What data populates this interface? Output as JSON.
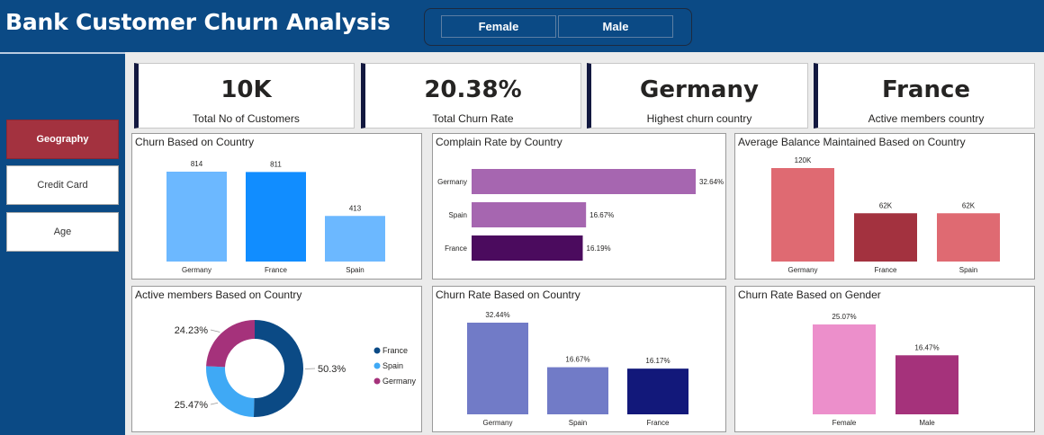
{
  "header": {
    "title": "Bank Customer Churn Analysis"
  },
  "gender_slicer": {
    "options": [
      "Female",
      "Male"
    ]
  },
  "sidebar": {
    "items": [
      {
        "label": "Geography",
        "active": true
      },
      {
        "label": "Credit Card",
        "active": false
      },
      {
        "label": "Age",
        "active": false
      }
    ]
  },
  "kpis": [
    {
      "value": "10K",
      "label": "Total No of Customers"
    },
    {
      "value": "20.38%",
      "label": "Total Churn Rate"
    },
    {
      "value": "Germany",
      "label": "Highest churn country"
    },
    {
      "value": "France",
      "label": "Active members country"
    }
  ],
  "colors": {
    "header": "#0b4a85",
    "active_nav": "#a3323f",
    "kpi_accent": "#12183f"
  },
  "chart_data": [
    {
      "type": "bar",
      "title": "Churn Based on Country",
      "categories": [
        "Germany",
        "France",
        "Spain"
      ],
      "values": [
        814,
        811,
        413
      ],
      "data_labels": [
        "814",
        "811",
        "413"
      ],
      "colors": [
        "#6cb8ff",
        "#118dff",
        "#6cb8ff"
      ]
    },
    {
      "type": "bar",
      "orientation": "horizontal",
      "title": "Complain Rate by Country",
      "categories": [
        "Germany",
        "Spain",
        "France"
      ],
      "values": [
        32.64,
        16.67,
        16.19
      ],
      "data_labels": [
        "32.64%",
        "16.67%",
        "16.19%"
      ],
      "colors": [
        "#a666b0",
        "#a666b0",
        "#4b0b5e"
      ]
    },
    {
      "type": "bar",
      "title": "Average Balance Maintained Based on Country",
      "categories": [
        "Germany",
        "France",
        "Spain"
      ],
      "values": [
        120,
        62,
        62
      ],
      "data_labels": [
        "120K",
        "62K",
        "62K"
      ],
      "colors": [
        "#df6a72",
        "#a3323f",
        "#df6a72"
      ]
    },
    {
      "type": "pie",
      "donut": true,
      "title": "Active members Based on Country",
      "categories": [
        "France",
        "Spain",
        "Germany"
      ],
      "values": [
        50.3,
        25.47,
        24.23
      ],
      "data_labels": [
        "50.3%",
        "25.47%",
        "24.23%"
      ],
      "colors": [
        "#0b4a85",
        "#3fa9f5",
        "#a5327b"
      ],
      "legend": "right"
    },
    {
      "type": "bar",
      "title": "Churn Rate Based on Country",
      "categories": [
        "Germany",
        "Spain",
        "France"
      ],
      "values": [
        32.44,
        16.67,
        16.17
      ],
      "data_labels": [
        "32.44%",
        "16.67%",
        "16.17%"
      ],
      "colors": [
        "#717bc7",
        "#717bc7",
        "#12187a"
      ]
    },
    {
      "type": "bar",
      "title": "Churn Rate Based on Gender",
      "categories": [
        "Female",
        "Male"
      ],
      "values": [
        25.07,
        16.47
      ],
      "data_labels": [
        "25.07%",
        "16.47%"
      ],
      "colors": [
        "#ec8fcb",
        "#a5327b"
      ]
    }
  ]
}
